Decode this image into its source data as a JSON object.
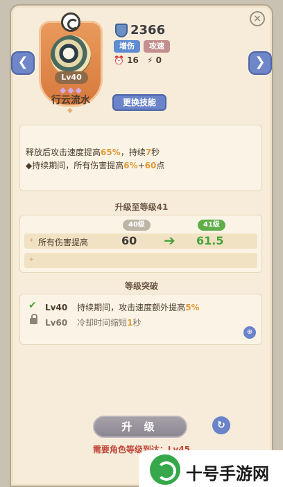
{
  "skill": {
    "level_badge": "Lv40",
    "stars": "◆◆◆",
    "name": "行云流水"
  },
  "power": {
    "value": "2366",
    "tags": [
      "增伤",
      "攻速"
    ],
    "stat_a": "16",
    "stat_b": "0"
  },
  "buttons": {
    "change_skill": "更换技能",
    "upgrade": "升 级",
    "prev": "❮",
    "next": "❯",
    "refresh": "↻",
    "zoom": "⊕",
    "close": "×"
  },
  "description": {
    "line1_a": "释放后攻击速度提高",
    "line1_b": "65%",
    "line1_c": "，持续",
    "line1_d": "7",
    "line1_e": "秒",
    "line2_a": "◆持续期间，所有伤害提高",
    "line2_b": "6%",
    "line2_c": "+",
    "line2_d": "60",
    "line2_e": "点"
  },
  "upgrade_section": {
    "title": "升级至等级41",
    "old_level": "40级",
    "new_level": "41级",
    "attribute": "所有伤害提高",
    "old_value": "60",
    "new_value": "61.5"
  },
  "breakthrough": {
    "title": "等级突破",
    "items": [
      {
        "level": "Lv40",
        "text_a": "持续期间，攻击速度额外提高",
        "text_b": "5%",
        "unlocked": true
      },
      {
        "level": "Lv60",
        "text_a": "冷却时间缩短",
        "text_b": "1",
        "text_c": "秒",
        "unlocked": false
      }
    ]
  },
  "requirement": "需要角色等级到达：Lv45",
  "logo": {
    "text": "十号手游网"
  },
  "colors": {
    "accent_blue": "#6a83c9",
    "highlight": "#e39a3a",
    "green": "#45a33a",
    "warning": "#c0473d"
  }
}
